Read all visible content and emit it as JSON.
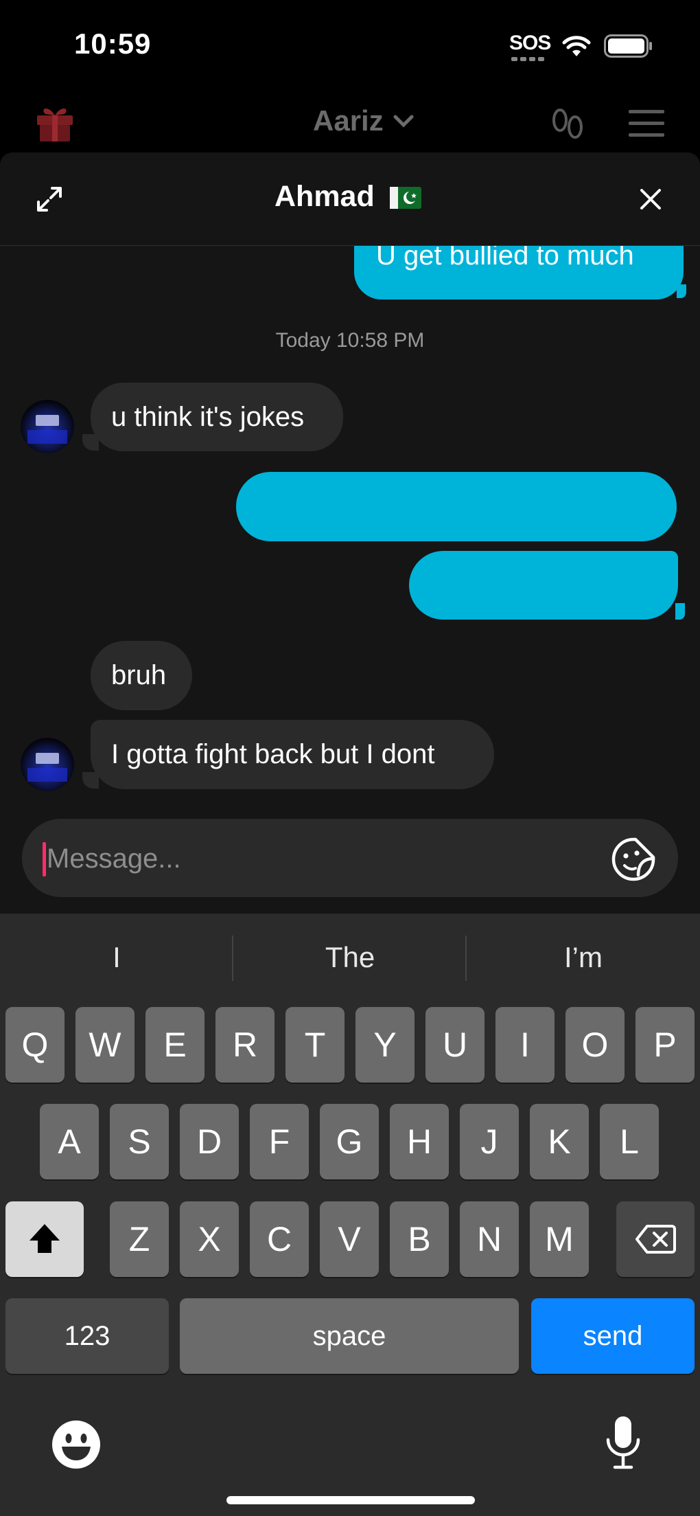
{
  "status_bar": {
    "time": "10:59",
    "sos": "SOS"
  },
  "app_header": {
    "profile_name": "Aariz"
  },
  "chat": {
    "title": "Ahmad",
    "flag_emoji": "🇵🇰",
    "timestamp": "Today 10:58 PM",
    "messages": [
      {
        "from": "me",
        "text": "U get bullied to much"
      },
      {
        "from": "them",
        "text": "u think it's jokes"
      },
      {
        "from": "me",
        "text": ""
      },
      {
        "from": "me",
        "text": ""
      },
      {
        "from": "them",
        "text": "bruh"
      },
      {
        "from": "them",
        "text": "I gotta fight back but I dont"
      }
    ]
  },
  "input": {
    "placeholder": "Message..."
  },
  "keyboard": {
    "suggestions": [
      "I",
      "The",
      "I’m"
    ],
    "row1": [
      "Q",
      "W",
      "E",
      "R",
      "T",
      "Y",
      "U",
      "I",
      "O",
      "P"
    ],
    "row2": [
      "A",
      "S",
      "D",
      "F",
      "G",
      "H",
      "J",
      "K",
      "L"
    ],
    "row3": [
      "Z",
      "X",
      "C",
      "V",
      "B",
      "N",
      "M"
    ],
    "numbers_label": "123",
    "space_label": "space",
    "send_label": "send"
  },
  "colors": {
    "outgoing": "#00b3d9",
    "incoming": "#2a2a2a",
    "send_key": "#0a84ff",
    "caret": "#ff2d6a"
  },
  "icons": [
    "gift-icon",
    "footprints-icon",
    "menu-icon",
    "expand-icon",
    "close-icon",
    "sticker-icon",
    "shift-icon",
    "backspace-icon",
    "emoji-icon",
    "mic-icon",
    "wifi-icon",
    "battery-icon"
  ]
}
